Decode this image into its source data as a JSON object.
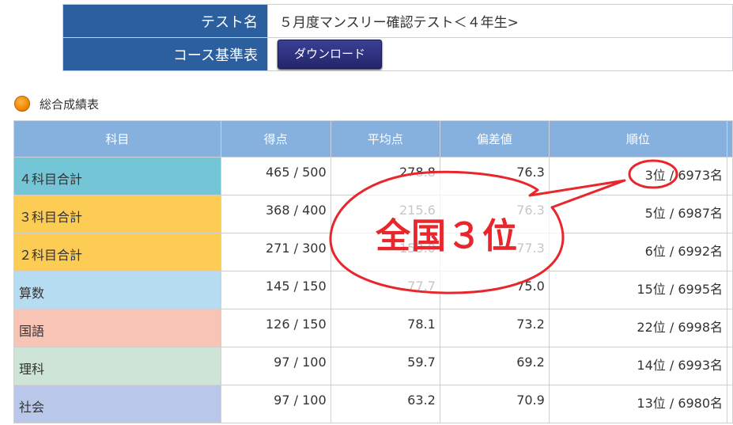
{
  "info": {
    "test_name_label": "テスト名",
    "test_name_value": "５月度マンスリー確認テスト＜４年生>",
    "course_label": "コース基準表",
    "download_label": "ダウンロード"
  },
  "section": {
    "title": "総合成績表"
  },
  "table": {
    "headers": [
      "科目",
      "得点",
      "平均点",
      "偏差値",
      "順位"
    ],
    "rows": [
      {
        "subject": "４科目合計",
        "score": "465 / 500",
        "avg": "278.8",
        "dev": "76.3",
        "rank": "3位 / 6973名",
        "color": "#74c6d6"
      },
      {
        "subject": "３科目合計",
        "score": "368 / 400",
        "avg": "215.6",
        "dev": "76.3",
        "rank": "5位 / 6987名",
        "color": "#fccc55"
      },
      {
        "subject": "２科目合計",
        "score": "271 / 300",
        "avg": "153.0",
        "dev": "77.3",
        "rank": "6位 / 6992名",
        "color": "#fccc55"
      },
      {
        "subject": "算数",
        "score": "145 / 150",
        "avg": "77.7",
        "dev": "75.0",
        "rank": "15位 / 6995名",
        "color": "#b5dcf1"
      },
      {
        "subject": "国語",
        "score": "126 / 150",
        "avg": "78.1",
        "dev": "73.2",
        "rank": "22位 / 6998名",
        "color": "#f7c4b5"
      },
      {
        "subject": "理科",
        "score": "97 / 100",
        "avg": "59.7",
        "dev": "69.2",
        "rank": "14位 / 6993名",
        "color": "#cde4d6"
      },
      {
        "subject": "社会",
        "score": "97 / 100",
        "avg": "63.2",
        "dev": "70.9",
        "rank": "13位 / 6980名",
        "color": "#b9c7e8"
      }
    ]
  },
  "annotation": {
    "text": "全国３位",
    "color": "#e8262b"
  }
}
